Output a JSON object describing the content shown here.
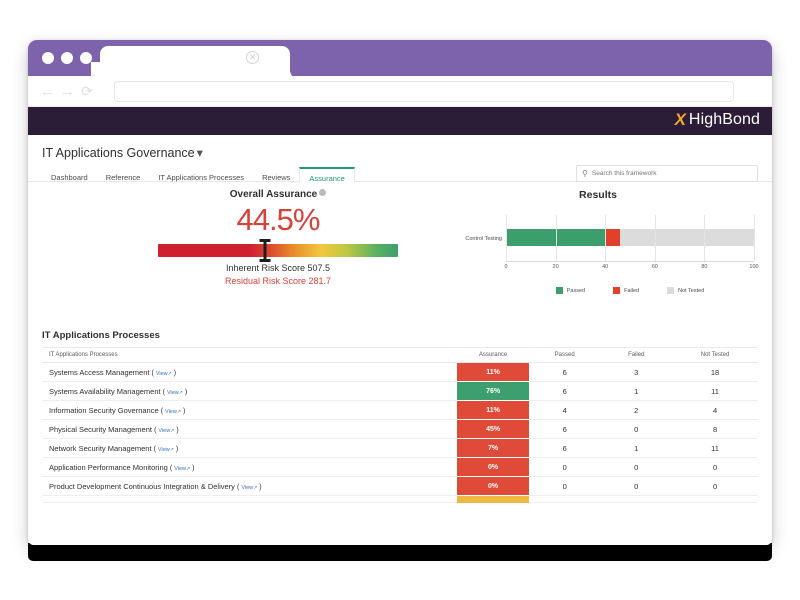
{
  "browser": {
    "tab_close_icon": "close-icon",
    "nav": {
      "back": "←",
      "forward": "→",
      "reload": "⟳"
    },
    "url_value": "",
    "url_placeholder": ""
  },
  "brand": {
    "mark": "X",
    "name": "HighBond",
    "mark_color": "#f2a829",
    "bar_color": "#2b1c38"
  },
  "header": {
    "title": "IT Applications Governance",
    "caret": "▾",
    "tabs": [
      {
        "label": "Dashboard",
        "active": false
      },
      {
        "label": "Reference",
        "active": false
      },
      {
        "label": "IT Applications Processes",
        "active": false
      },
      {
        "label": "Reviews",
        "active": false
      },
      {
        "label": "Assurance",
        "active": true
      }
    ],
    "search": {
      "icon": "search-icon",
      "placeholder": "Search this framework",
      "value": ""
    }
  },
  "assurance": {
    "title": "Overall Assurance",
    "info_icon": "info-icon",
    "value": "44.5%",
    "value_color": "#d6433a",
    "marker_percent": 44.5,
    "inherent_label": "Inherent Risk Score 507.5",
    "residual_label": "Residual Risk Score 281.7"
  },
  "chart_data": {
    "type": "bar",
    "title": "Results",
    "orientation": "horizontal",
    "stacked": true,
    "categories": [
      "Control Testing"
    ],
    "series": [
      {
        "name": "Passed",
        "values": [
          40
        ],
        "color": "#3c9d6d"
      },
      {
        "name": "Failed",
        "values": [
          6
        ],
        "color": "#e2402a"
      },
      {
        "name": "Not Tested",
        "values": [
          54
        ],
        "color": "#dcdcdc"
      }
    ],
    "xlabel": "",
    "ylabel": "",
    "xlim": [
      0,
      100
    ],
    "xticks": [
      0,
      20,
      40,
      60,
      80,
      100
    ],
    "grid": true,
    "legend_position": "bottom"
  },
  "table": {
    "heading": "IT Applications Processes",
    "columns": [
      "IT Applications Processes",
      "Assurance",
      "Passed",
      "Failed",
      "Not Tested"
    ],
    "view_label": "View",
    "view_arrow": "↗",
    "rows": [
      {
        "name": "Systems Access Management",
        "assurance": "11%",
        "assurance_color": "#e04b39",
        "passed": "6",
        "failed": "3",
        "not_tested": "18"
      },
      {
        "name": "Systems Availability Management",
        "assurance": "76%",
        "assurance_color": "#3d9e70",
        "passed": "6",
        "failed": "1",
        "not_tested": "11"
      },
      {
        "name": "Information Security Governance",
        "assurance": "11%",
        "assurance_color": "#e04b39",
        "passed": "4",
        "failed": "2",
        "not_tested": "4"
      },
      {
        "name": "Physical Security Management",
        "assurance": "45%",
        "assurance_color": "#e04b39",
        "passed": "6",
        "failed": "0",
        "not_tested": "8"
      },
      {
        "name": "Network Security Management",
        "assurance": "7%",
        "assurance_color": "#e04b39",
        "passed": "6",
        "failed": "1",
        "not_tested": "11"
      },
      {
        "name": "Application Performance Monitoring",
        "assurance": "0%",
        "assurance_color": "#e04b39",
        "passed": "0",
        "failed": "0",
        "not_tested": "0"
      },
      {
        "name": "Product Development Continuous Integration & Delivery",
        "assurance": "0%",
        "assurance_color": "#e04b39",
        "passed": "0",
        "failed": "0",
        "not_tested": "0"
      }
    ],
    "partial_row_color": "#eeb942"
  }
}
